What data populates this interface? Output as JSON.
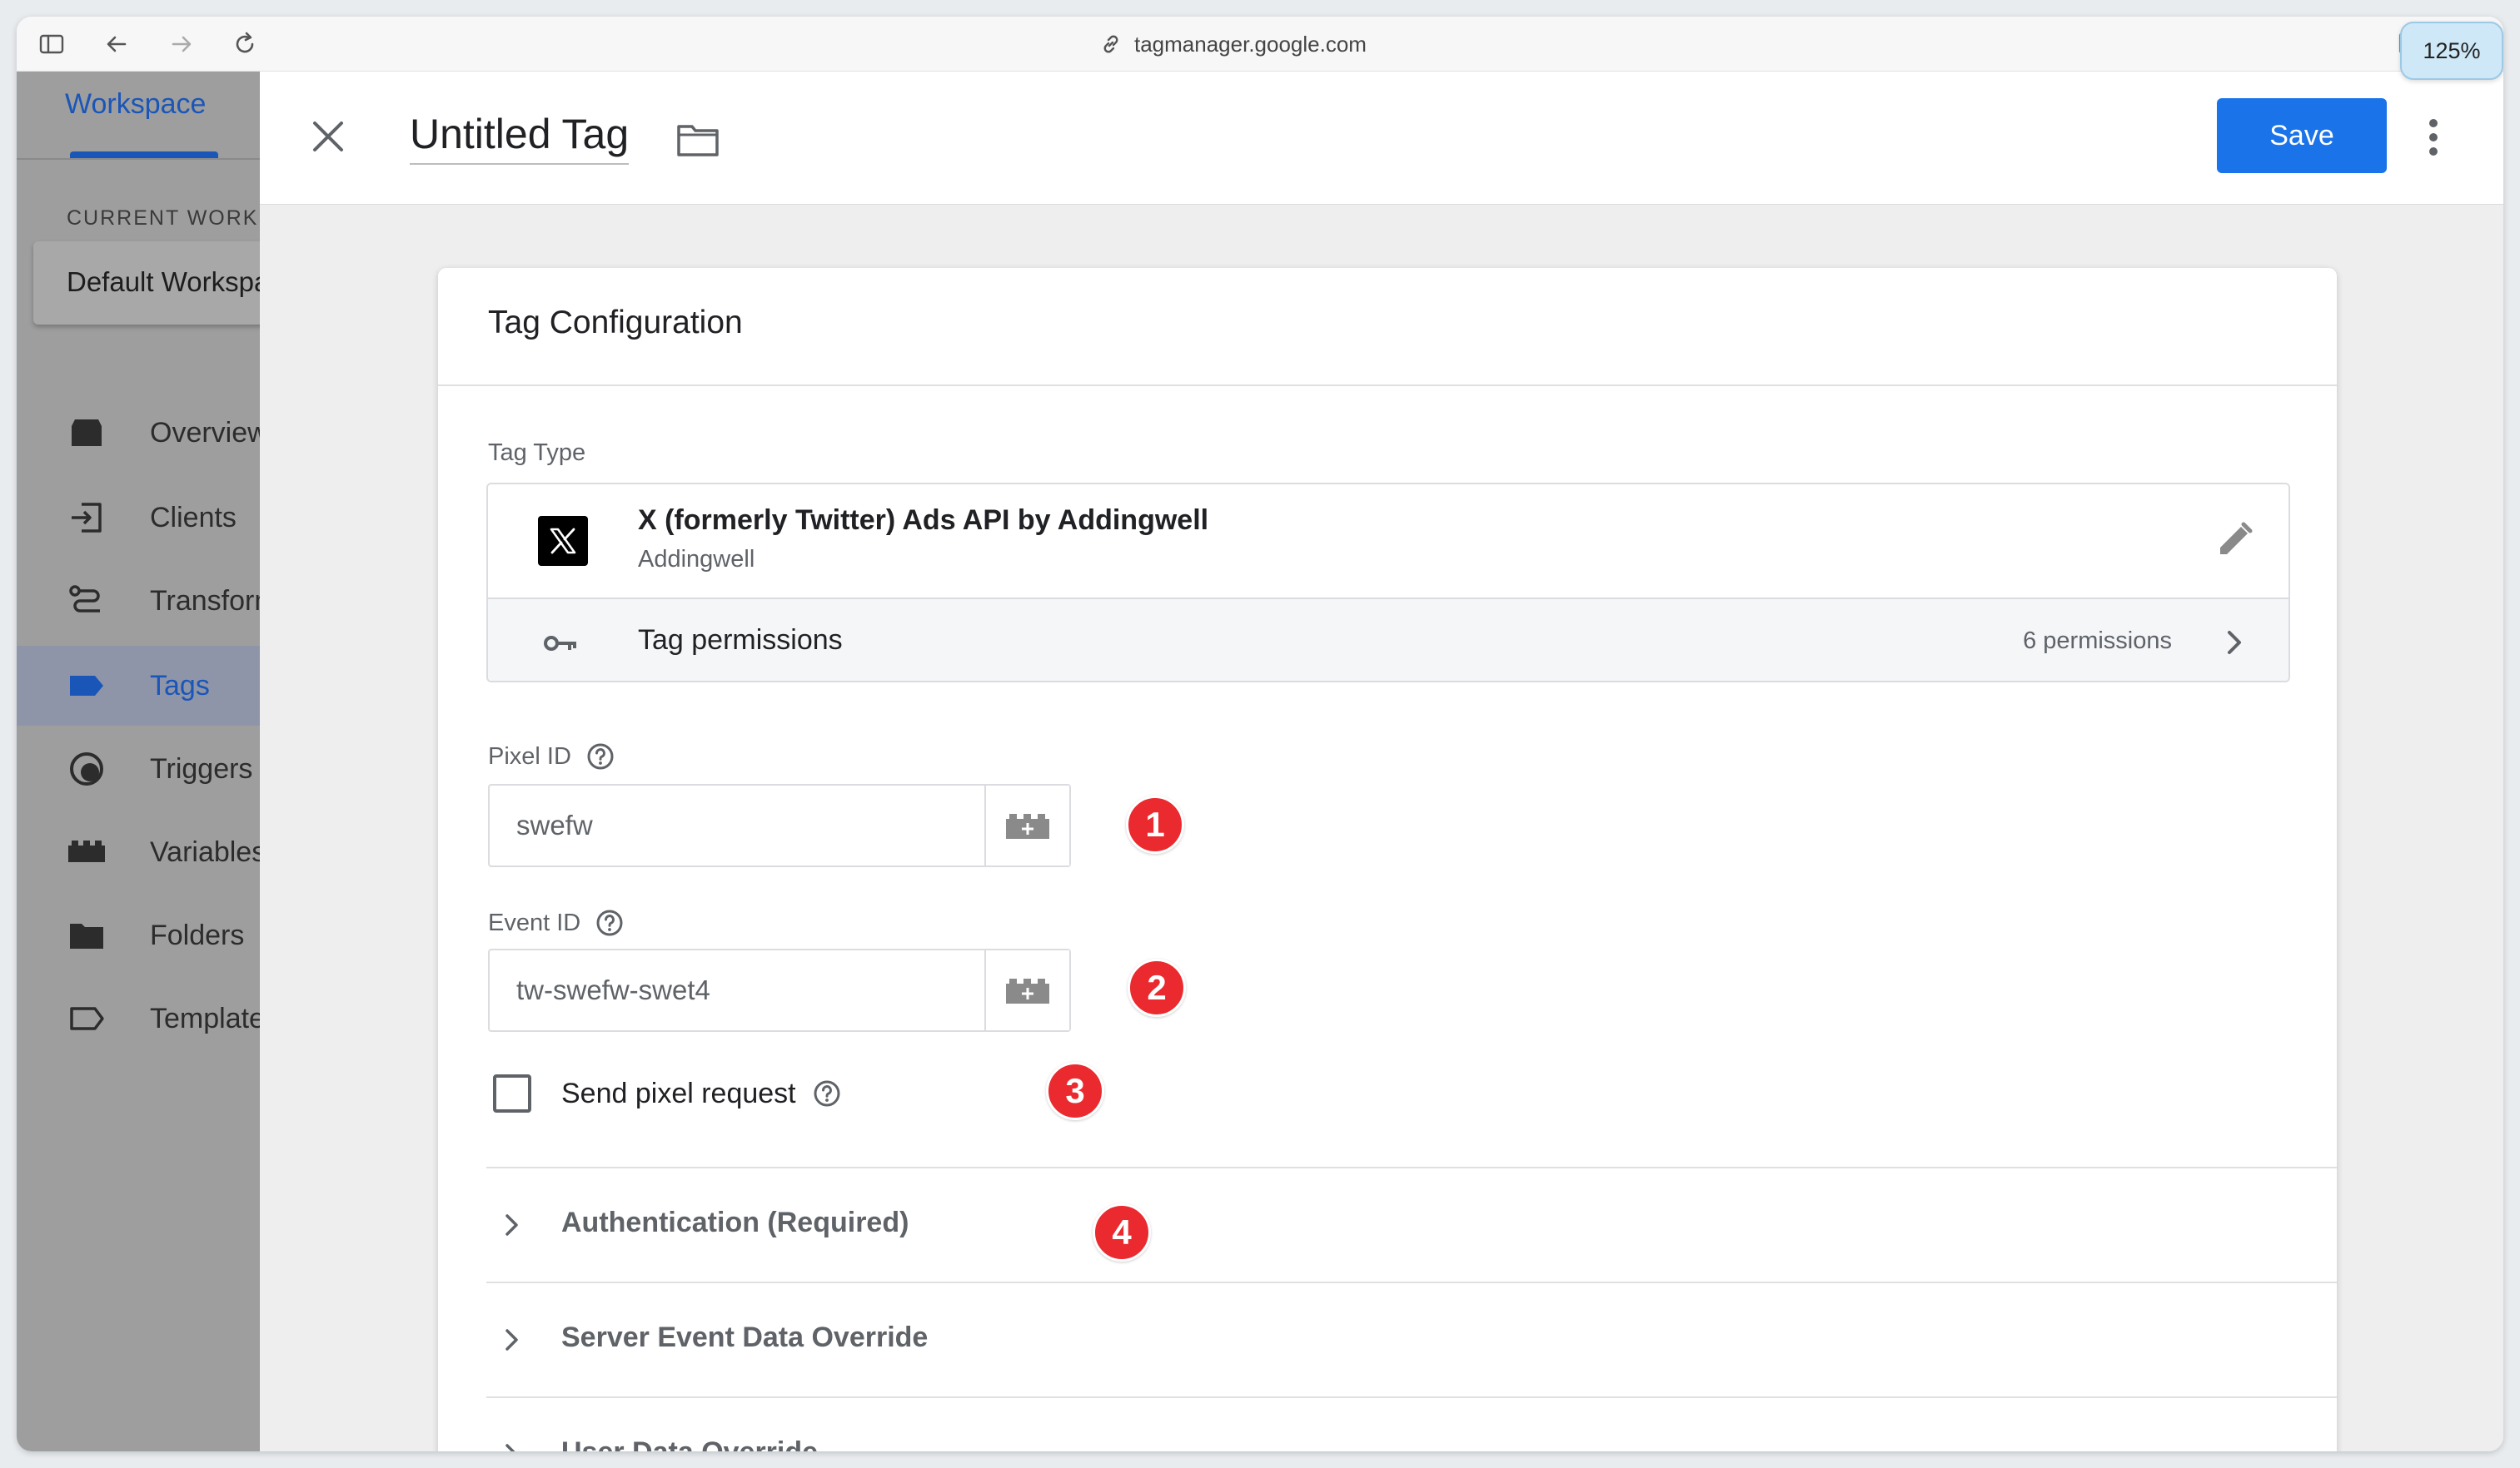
{
  "browser": {
    "url": "tagmanager.google.com",
    "zoom": "125%"
  },
  "sidebar": {
    "workspace_tab": "Workspace",
    "current_workspace_label": "CURRENT WORKSPACE",
    "current_workspace_name": "Default Workspace",
    "items": [
      {
        "label": "Overview",
        "icon": "overview-icon",
        "active": false
      },
      {
        "label": "Clients",
        "icon": "clients-icon",
        "active": false
      },
      {
        "label": "Transformations",
        "icon": "transformations-icon",
        "active": false
      },
      {
        "label": "Tags",
        "icon": "tag-icon",
        "active": true
      },
      {
        "label": "Triggers",
        "icon": "trigger-icon",
        "active": false
      },
      {
        "label": "Variables",
        "icon": "variables-icon",
        "active": false
      },
      {
        "label": "Folders",
        "icon": "folder-icon",
        "active": false
      },
      {
        "label": "Templates",
        "icon": "template-icon",
        "active": false
      }
    ]
  },
  "header": {
    "title": "Untitled Tag",
    "save_label": "Save"
  },
  "card": {
    "title": "Tag Configuration",
    "tag_type_label": "Tag Type",
    "tag_type": {
      "name": "X (formerly Twitter) Ads API by Addingwell",
      "vendor": "Addingwell",
      "permissions_label": "Tag permissions",
      "permissions_count": "6 permissions"
    },
    "pixel_id": {
      "label": "Pixel ID",
      "value": "swefw",
      "badge": "1"
    },
    "event_id": {
      "label": "Event ID",
      "value": "tw-swefw-swet4",
      "badge": "2"
    },
    "send_pixel": {
      "label": "Send pixel request",
      "checked": false,
      "badge": "3"
    },
    "sections": [
      {
        "label": "Authentication (Required)",
        "badge": "4"
      },
      {
        "label": "Server Event Data Override"
      },
      {
        "label": "User Data Override"
      }
    ]
  },
  "colors": {
    "accent": "#1a73e8",
    "badge": "#ea2a2f",
    "sidebar_overlay": "#9e9e9e"
  }
}
